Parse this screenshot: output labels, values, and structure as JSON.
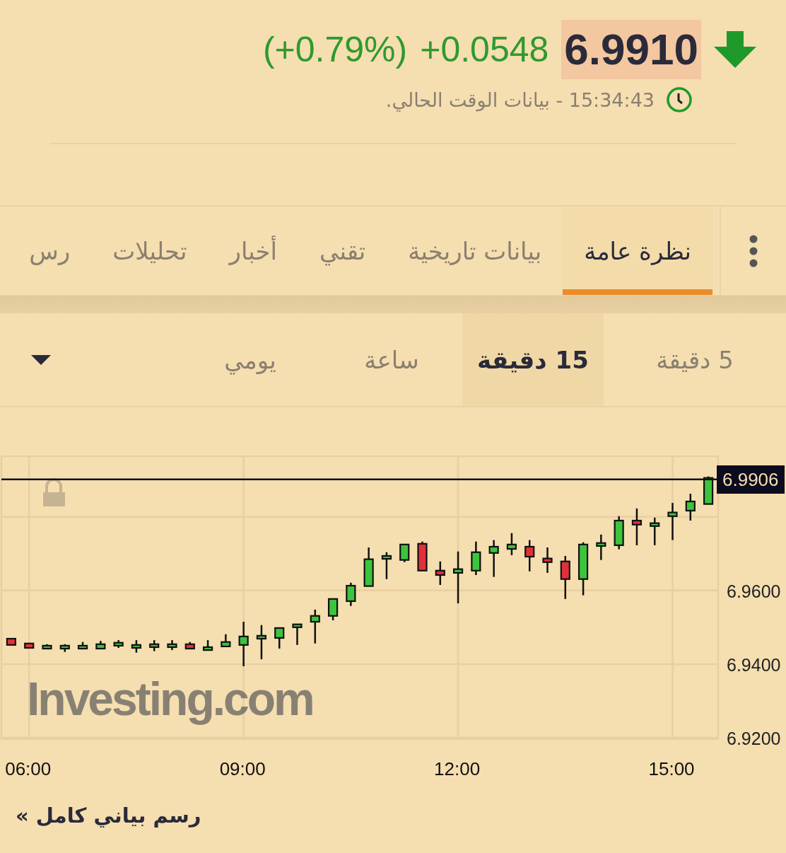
{
  "quote": {
    "price": "6.9910",
    "change": "+0.0548",
    "change_percent": "(+0.79%)",
    "gain": true
  },
  "timestamp": "15:34:43 - بيانات الوقت الحالي.",
  "tabs": [
    {
      "label": "نظرة عامة",
      "selected": true
    },
    {
      "label": "بيانات تاريخية",
      "selected": false
    },
    {
      "label": "تقني",
      "selected": false
    },
    {
      "label": "أخبار",
      "selected": false
    },
    {
      "label": "تحليلات",
      "selected": false
    },
    {
      "label": "رس",
      "selected": false
    }
  ],
  "intervals": [
    {
      "label": "5 دقيقة",
      "selected": false
    },
    {
      "label": "15 دقيقة",
      "selected": true
    },
    {
      "label": "ساعة",
      "selected": false
    },
    {
      "label": "يومي",
      "selected": false
    }
  ],
  "chart": {
    "current_price": "6.9906",
    "logo": "Investing.com",
    "chart_data": {
      "type": "candlestick",
      "categories": [
        null,
        "06:00",
        null,
        null,
        null,
        null,
        null,
        null,
        null,
        null,
        null,
        null,
        null,
        "09:00",
        null,
        null,
        null,
        null,
        null,
        null,
        null,
        null,
        null,
        null,
        null,
        "12:00",
        null,
        null,
        null,
        null,
        null,
        null,
        null,
        null,
        null,
        null,
        null,
        "15:00",
        null,
        null
      ],
      "ohlc": [
        [
          6.9469,
          6.9469,
          6.9452,
          6.9452
        ],
        [
          6.9456,
          6.9456,
          6.9444,
          6.9444
        ],
        [
          6.9442,
          6.9454,
          6.9442,
          6.945
        ],
        [
          6.9442,
          6.9454,
          6.9433,
          6.945
        ],
        [
          6.9442,
          6.946,
          6.9442,
          6.945
        ],
        [
          6.9442,
          6.9463,
          6.9442,
          6.9454
        ],
        [
          6.945,
          6.9465,
          6.9444,
          6.9458
        ],
        [
          6.9444,
          6.9465,
          6.9431,
          6.9452
        ],
        [
          6.9446,
          6.9465,
          6.9435,
          6.9454
        ],
        [
          6.9446,
          6.9465,
          6.9438,
          6.9454
        ],
        [
          6.9454,
          6.946,
          6.9442,
          6.9442
        ],
        [
          6.9438,
          6.9465,
          6.9438,
          6.9446
        ],
        [
          6.9448,
          6.9481,
          6.9448,
          6.946
        ],
        [
          6.9452,
          6.9515,
          6.9394,
          6.9475
        ],
        [
          6.9469,
          6.9506,
          6.9413,
          6.9477
        ],
        [
          6.9471,
          6.9498,
          6.9442,
          6.9498
        ],
        [
          6.95,
          6.9508,
          6.9452,
          6.9508
        ],
        [
          6.9515,
          6.9548,
          6.9456,
          6.9531
        ],
        [
          6.9531,
          6.9577,
          6.9519,
          6.9577
        ],
        [
          6.9571,
          6.9621,
          6.9558,
          6.9613
        ],
        [
          6.9612,
          6.9717,
          6.9612,
          6.9685
        ],
        [
          6.9686,
          6.9704,
          6.9631,
          6.9694
        ],
        [
          6.9683,
          6.9725,
          6.9677,
          6.9725
        ],
        [
          6.9727,
          6.9733,
          6.9654,
          6.9654
        ],
        [
          6.9654,
          6.9679,
          6.9615,
          6.9642
        ],
        [
          6.9648,
          6.9706,
          6.9565,
          6.9658
        ],
        [
          6.9654,
          6.9733,
          6.9642,
          6.9704
        ],
        [
          6.9702,
          6.9737,
          6.9637,
          6.9719
        ],
        [
          6.9713,
          6.9756,
          6.9696,
          6.9725
        ],
        [
          6.9719,
          6.9737,
          6.9652,
          6.9692
        ],
        [
          6.9687,
          6.9717,
          6.9648,
          6.9677
        ],
        [
          6.9679,
          6.9694,
          6.9577,
          6.9631
        ],
        [
          6.9631,
          6.9731,
          6.9587,
          6.9725
        ],
        [
          6.9721,
          6.9752,
          6.9683,
          6.9729
        ],
        [
          6.9723,
          6.9802,
          6.9712,
          6.979
        ],
        [
          6.979,
          6.9823,
          6.9723,
          6.9779
        ],
        [
          6.9775,
          6.9798,
          6.9723,
          6.9783
        ],
        [
          6.9802,
          6.9838,
          6.9737,
          6.9812
        ],
        [
          6.9817,
          6.9863,
          6.979,
          6.9842
        ],
        [
          6.9835,
          6.991,
          6.9835,
          6.9906
        ]
      ],
      "ylim": [
        6.9196,
        6.9965
      ],
      "grid": true,
      "yticks": [
        {
          "value": 6.96,
          "label": "6.9600"
        },
        {
          "value": 6.94,
          "label": "6.9400"
        },
        {
          "value": 6.92,
          "label": "6.9200"
        }
      ]
    }
  },
  "full_chart_link": "رسم بياني كامل »"
}
